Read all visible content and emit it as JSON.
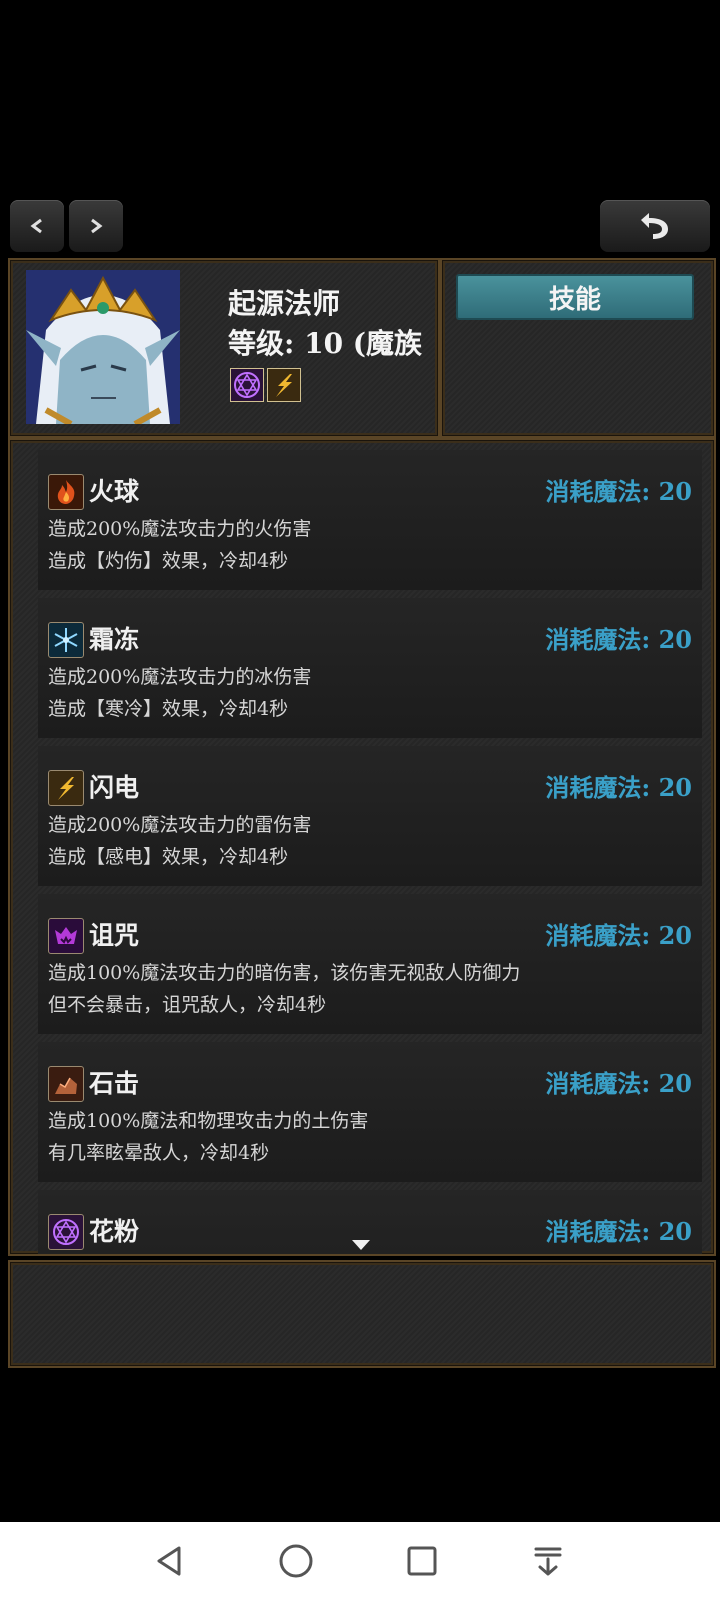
{
  "header": {
    "name": "起源法师",
    "level_label": "等级: 10 (魔族",
    "tab_label": "技能"
  },
  "skills": [
    {
      "name": "火球",
      "cost": "消耗魔法: 20",
      "desc1": "造成200%魔法攻击力的火伤害",
      "desc2": "造成【灼伤】效果，冷却4秒",
      "icon": "fire-icon"
    },
    {
      "name": "霜冻",
      "cost": "消耗魔法: 20",
      "desc1": "造成200%魔法攻击力的冰伤害",
      "desc2": "造成【寒冷】效果，冷却4秒",
      "icon": "snowflake-icon"
    },
    {
      "name": "闪电",
      "cost": "消耗魔法: 20",
      "desc1": "造成200%魔法攻击力的雷伤害",
      "desc2": "造成【感电】效果，冷却4秒",
      "icon": "lightning-icon"
    },
    {
      "name": "诅咒",
      "cost": "消耗魔法: 20",
      "desc1": "造成100%魔法攻击力的暗伤害，该伤害无视敌人防御力",
      "desc2": "但不会暴击，诅咒敌人，冷却4秒",
      "icon": "curse-icon"
    },
    {
      "name": "石击",
      "cost": "消耗魔法: 20",
      "desc1": "造成100%魔法和物理攻击力的土伤害",
      "desc2": "有几率眩晕敌人，冷却4秒",
      "icon": "stone-icon"
    },
    {
      "name": "花粉",
      "cost": "消耗魔法: 20",
      "desc1": "",
      "desc2": "",
      "icon": "hexagram-icon"
    }
  ],
  "colors": {
    "cost": "#3aa0c8",
    "border": "#5a4526",
    "tab": "#3d7f8a"
  }
}
